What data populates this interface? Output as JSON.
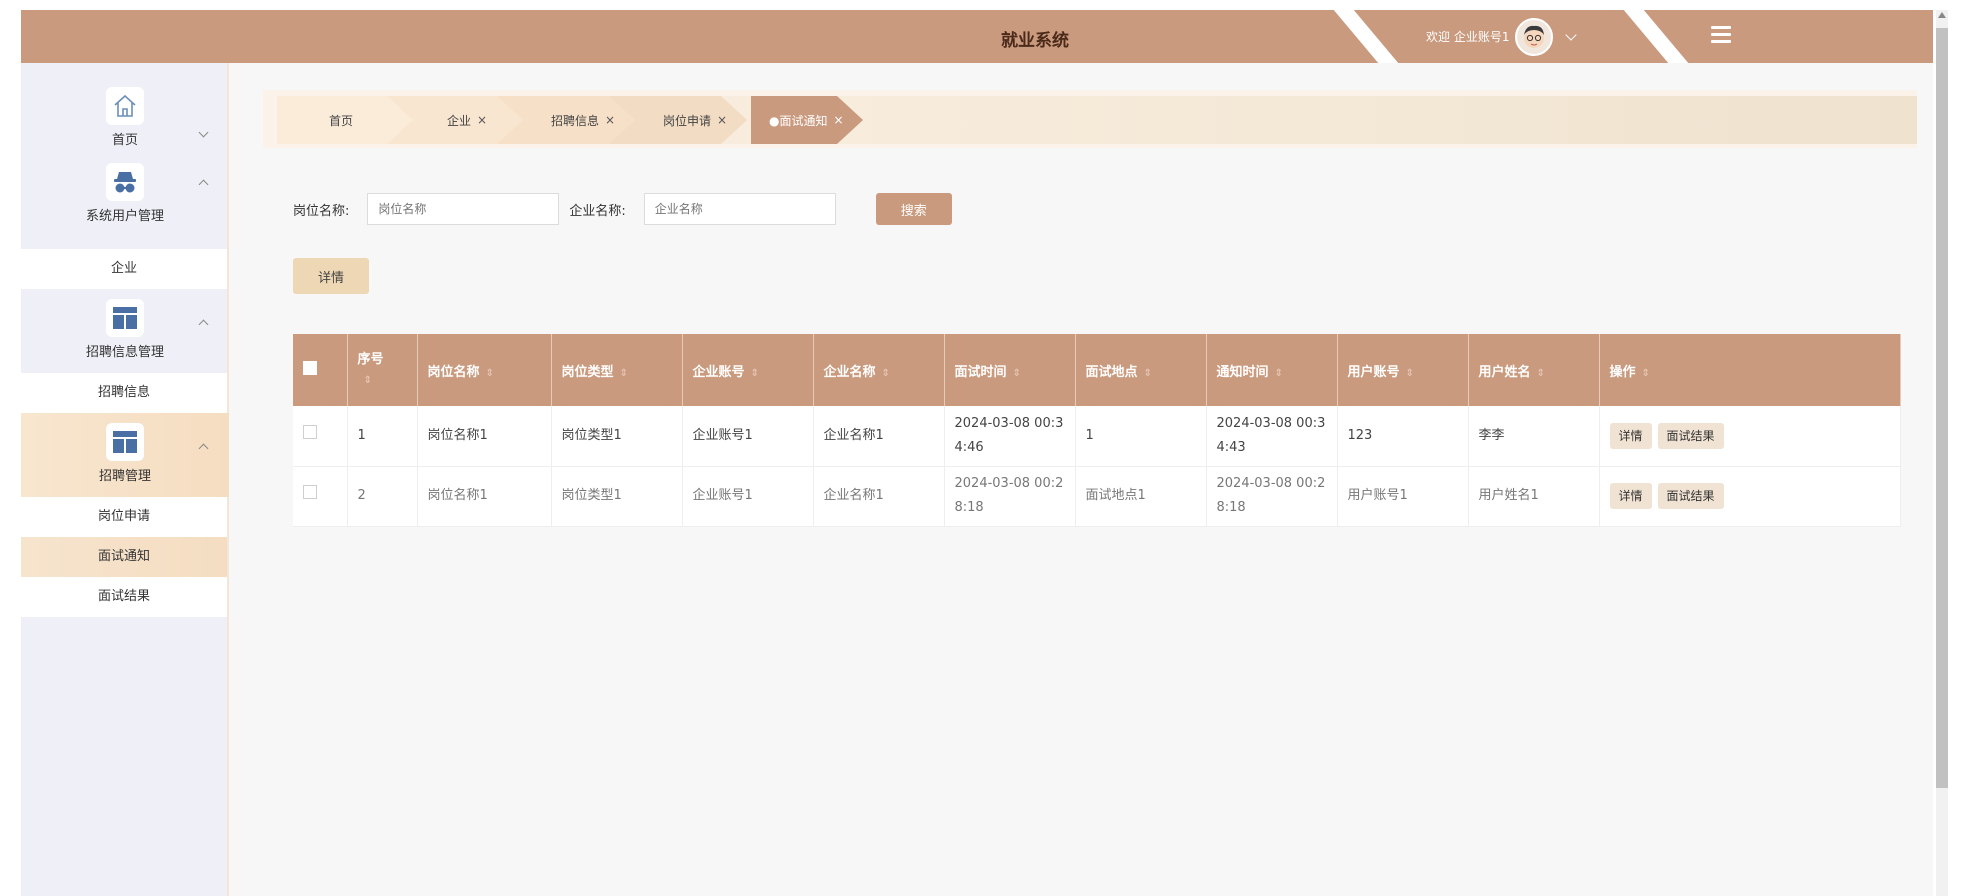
{
  "header": {
    "title": "就业系统",
    "welcome": "欢迎 企业账号1",
    "colors": {
      "primary": "#c99a7e",
      "active_bg": "#f5ddc1"
    }
  },
  "sidebar": {
    "groups": [
      {
        "label": "首页",
        "icon": "home-icon",
        "expanded": false,
        "items": []
      },
      {
        "label": "系统用户管理",
        "icon": "user-spy-icon",
        "expanded": true,
        "items": [
          "企业"
        ]
      },
      {
        "label": "招聘信息管理",
        "icon": "layout-icon",
        "expanded": true,
        "items": [
          "招聘信息"
        ]
      },
      {
        "label": "招聘管理",
        "icon": "layout-icon",
        "expanded": true,
        "items": [
          "岗位申请",
          "面试通知",
          "面试结果"
        ]
      }
    ],
    "active_item": "面试通知"
  },
  "breadcrumb": {
    "items": [
      {
        "label": "首页",
        "closable": false
      },
      {
        "label": "企业",
        "closable": true
      },
      {
        "label": "招聘信息",
        "closable": true
      },
      {
        "label": "岗位申请",
        "closable": true
      },
      {
        "label": "●面试通知",
        "closable": true,
        "active": true
      }
    ],
    "close_glyph": "×"
  },
  "search": {
    "job_name_label": "岗位名称:",
    "job_name_placeholder": "岗位名称",
    "company_name_label": "企业名称:",
    "company_name_placeholder": "企业名称",
    "search_button": "搜索"
  },
  "toolbar": {
    "detail_button": "详情"
  },
  "table": {
    "columns": [
      "序号",
      "岗位名称",
      "岗位类型",
      "企业账号",
      "企业名称",
      "面试时间",
      "面试地点",
      "通知时间",
      "用户账号",
      "用户姓名",
      "操作"
    ],
    "rows": [
      {
        "index": "1",
        "job_name": "岗位名称1",
        "job_type": "岗位类型1",
        "company_account": "企业账号1",
        "company_name": "企业名称1",
        "interview_time": "2024-03-08 00:34:46",
        "interview_place": "1",
        "notify_time": "2024-03-08 00:34:43",
        "user_account": "123",
        "user_name": "李李"
      },
      {
        "index": "2",
        "job_name": "岗位名称1",
        "job_type": "岗位类型1",
        "company_account": "企业账号1",
        "company_name": "企业名称1",
        "interview_time": "2024-03-08 00:28:18",
        "interview_place": "面试地点1",
        "notify_time": "2024-03-08 00:28:18",
        "user_account": "用户账号1",
        "user_name": "用户姓名1"
      }
    ],
    "row_actions": {
      "detail": "详情",
      "result": "面试结果"
    }
  }
}
